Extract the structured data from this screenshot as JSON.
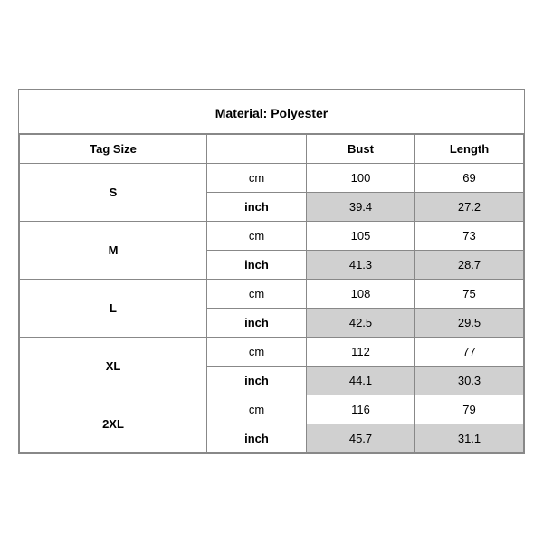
{
  "title": "Material: Polyester",
  "headers": {
    "tagSize": "Tag Size",
    "unit": "",
    "bust": "Bust",
    "length": "Length"
  },
  "rows": [
    {
      "size": "S",
      "cm": {
        "bust": "100",
        "length": "69"
      },
      "inch": {
        "bust": "39.4",
        "length": "27.2"
      }
    },
    {
      "size": "M",
      "cm": {
        "bust": "105",
        "length": "73"
      },
      "inch": {
        "bust": "41.3",
        "length": "28.7"
      }
    },
    {
      "size": "L",
      "cm": {
        "bust": "108",
        "length": "75"
      },
      "inch": {
        "bust": "42.5",
        "length": "29.5"
      }
    },
    {
      "size": "XL",
      "cm": {
        "bust": "112",
        "length": "77"
      },
      "inch": {
        "bust": "44.1",
        "length": "30.3"
      }
    },
    {
      "size": "2XL",
      "cm": {
        "bust": "116",
        "length": "79"
      },
      "inch": {
        "bust": "45.7",
        "length": "31.1"
      }
    }
  ],
  "units": {
    "cm": "cm",
    "inch": "inch"
  }
}
